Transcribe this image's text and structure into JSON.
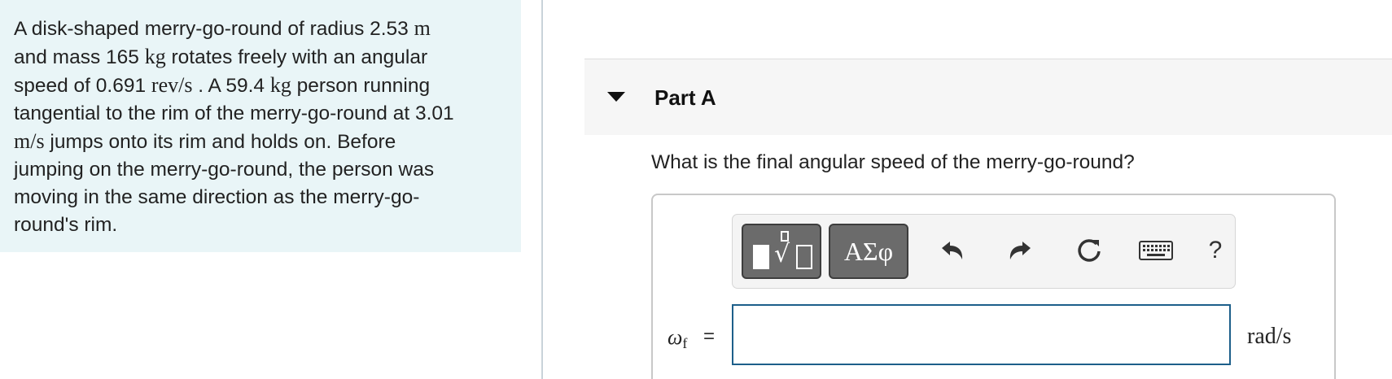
{
  "problem": {
    "t1": "A disk-shaped merry-go-round of radius 2.53 ",
    "u_m": "m",
    "t2": "and mass 165 ",
    "u_kg": "kg",
    "t3": " rotates freely with an angular",
    "t4": "speed of 0.691 ",
    "u_revs": "rev/s",
    "t5": " . A 59.4 ",
    "u_kg2": "kg",
    "t6": " person running",
    "t7": "tangential to the rim of the merry-go-round at 3.01",
    "u_ms": "m/s",
    "t8": " jumps onto its rim and holds on. Before",
    "t9": "jumping on the merry-go-round, the person was",
    "t10": "moving in the same direction as the merry-go-",
    "t11": "round's rim."
  },
  "part": {
    "title": "Part A"
  },
  "question": "What is the final angular speed of the merry-go-round?",
  "toolbar": {
    "greek_label": "ΑΣφ",
    "help_label": "?"
  },
  "answer": {
    "variable": "ω",
    "subscript": "f",
    "equals": "=",
    "value": "",
    "units": "rad/s"
  }
}
